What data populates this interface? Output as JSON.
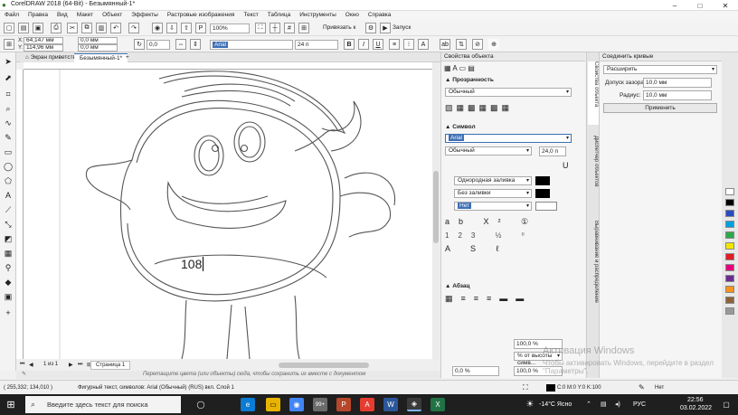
{
  "window": {
    "title": "CorelDRAW 2018 (64-Bit) - Безымянный-1*"
  },
  "menu": [
    "Файл",
    "Правка",
    "Вид",
    "Макет",
    "Объект",
    "Эффекты",
    "Растровые изображения",
    "Текст",
    "Таблица",
    "Инструменты",
    "Окно",
    "Справка"
  ],
  "toolbar": {
    "zoom": "100%",
    "snap": "Привязать к",
    "launch": "Запуск"
  },
  "propbar": {
    "x": "64,147 мм",
    "y": "114,96 мм",
    "w": "0,0 мм",
    "h": "0,0 мм",
    "angle": "0,0",
    "font": "Arial",
    "size": "24 п"
  },
  "tabs": {
    "welcome": "Экран приветствия",
    "doc": "Безымянный-1*"
  },
  "canvas_text": "108",
  "pagebar": {
    "page_counter": "1 из 1",
    "page": "Страница 1"
  },
  "hint": "Перетащите цвета (или объекты) сюда, чтобы сохранить их вместе с документом",
  "props_panel": {
    "title": "Свойства объекта",
    "transparency": "Прозрачность",
    "normal": "Обычный",
    "symbol": "Символ",
    "font": "Arial",
    "style": "Обычный",
    "size": "24,0 п",
    "fill": "Однородная заливка",
    "nofill": "Без заливки",
    "outline": "Нет",
    "para": "Абзац",
    "pct1": "100,0 %",
    "pct2": "% от высоты симв...",
    "pct3": "0,0 %",
    "pct4": "100,0 %"
  },
  "vtabs": [
    "Свойства объекта",
    "Диспетчер объектов",
    "Выравнивание и распределение"
  ],
  "join_panel": {
    "title": "Соединить кривые",
    "mode": "Расширить",
    "gap_label": "Допуск зазора:",
    "gap": "10,0 мм",
    "radius_label": "Радиус:",
    "radius": "10,0 мм",
    "apply": "Применить"
  },
  "status": {
    "coords": "( 255,332; 134,010 )",
    "info": "Фигурный текст, символов: Arial (Обычный) (RUS) вкл. Слой 1",
    "color": "C:0 M:0 Y:0 K:100",
    "outline": "Нет"
  },
  "activation": {
    "line1": "Активация Windows",
    "line2": "Чтобы активировать Windows, перейдите в раздел \"Параметры\"."
  },
  "taskbar": {
    "search": "Введите здесь текст для поиска",
    "weather": "-14°C Ясно",
    "lang": "РУС",
    "time": "22:56",
    "date": "03.02.2022",
    "badge": "99+"
  },
  "colors": {
    "accent": "#3d6fb5",
    "taskbar": "#1f1f1f"
  }
}
